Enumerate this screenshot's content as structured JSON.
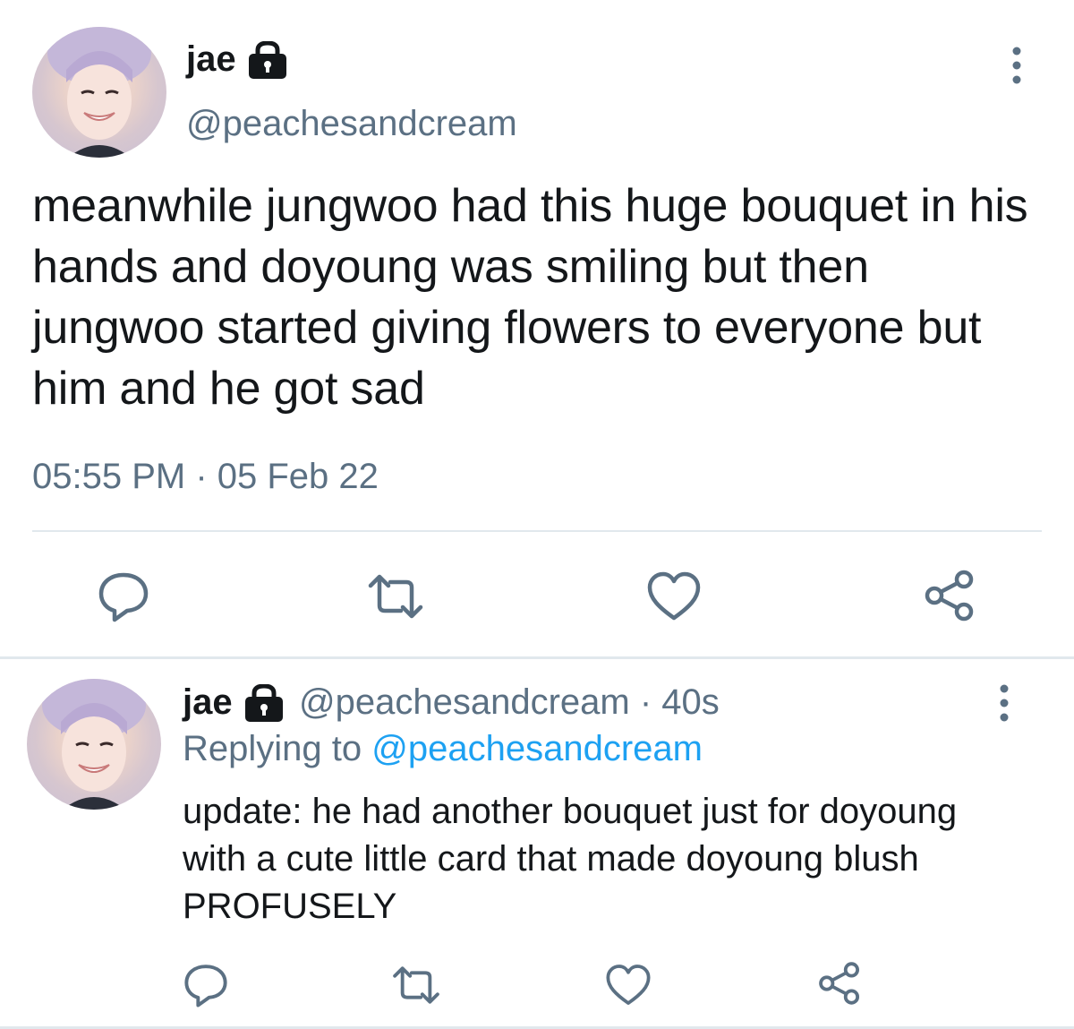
{
  "main_tweet": {
    "display_name": "jae",
    "handle": "@peachesandcream",
    "text": "meanwhile jungwoo had this huge bouquet in his hands and doyoung was smiling but then jungwoo started giving flowers to everyone but him and he got sad",
    "timestamp": "05:55 PM · 05 Feb 22",
    "icons": {
      "lock": "lock-icon",
      "more": "more-vertical-icon",
      "reply": "reply-icon",
      "retweet": "retweet-icon",
      "like": "heart-icon",
      "share": "share-icon"
    }
  },
  "reply_tweet": {
    "display_name": "jae",
    "meta": "@peachesandcream · 40s",
    "replying_prefix": "Replying to",
    "replying_to": "@peachesandcream",
    "text": "update: he had another bouquet just for doyoung with a cute little card that made doyoung blush PROFUSELY"
  },
  "colors": {
    "text_primary": "#14171a",
    "text_secondary": "#5b7083",
    "link": "#1da1f2",
    "divider": "#e1e8ed"
  }
}
